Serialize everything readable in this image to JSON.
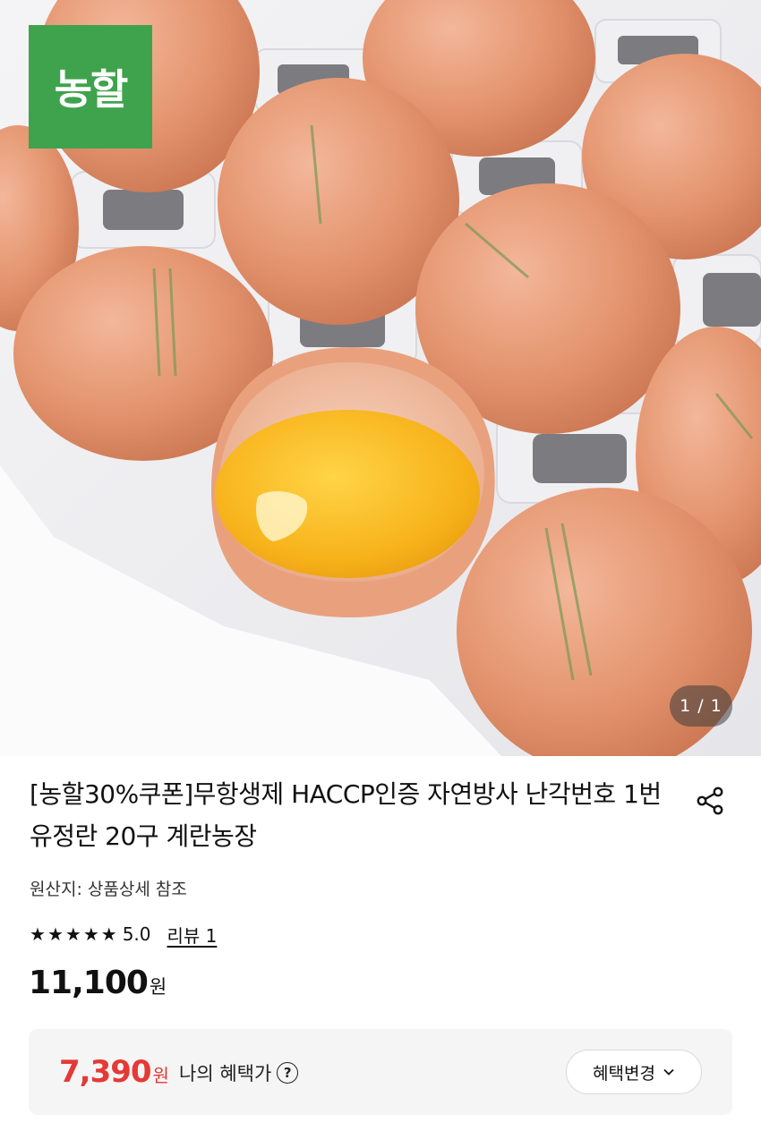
{
  "hero": {
    "brand_badge": "농할",
    "image_counter": "1 / 1"
  },
  "product": {
    "title": "[농할30%쿠폰]무항생제 HACCP인증 자연방사 난각번호 1번 유정란 20구 계란농장",
    "origin": "원산지: 상품상세 참조",
    "rating": {
      "stars_filled": 5,
      "stars_total": 5,
      "value": "5.0",
      "review_link": "리뷰 1"
    },
    "price": {
      "amount": "11,100",
      "unit": "원"
    }
  },
  "benefit": {
    "amount": "7,390",
    "unit": "원",
    "label": "나의 혜택가",
    "help_icon_glyph": "?",
    "change_button": "혜택변경"
  },
  "colors": {
    "brand_green": "#3fa34d",
    "benefit_red": "#e53935"
  },
  "icons": {
    "share": "share-icon",
    "help": "help-circle-icon",
    "chevron": "chevron-down-icon",
    "star": "star-icon"
  }
}
